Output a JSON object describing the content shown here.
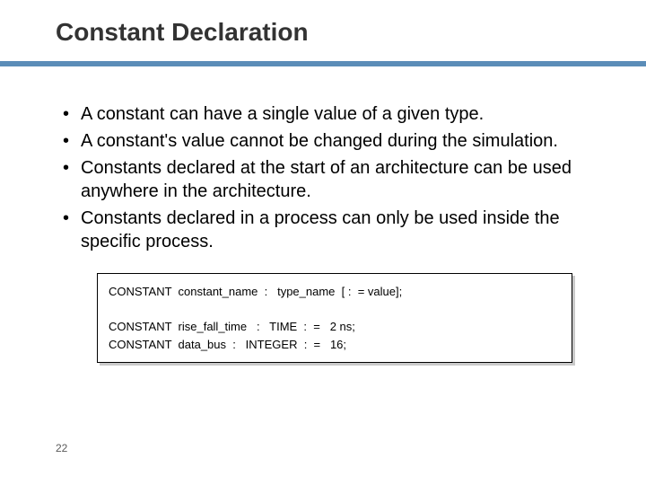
{
  "slide": {
    "title": "Constant Declaration",
    "bullets": [
      "A constant can have a single value of a given type.",
      "A constant's value cannot be changed during the simulation.",
      "Constants declared at the start of an architecture can be used anywhere in the architecture.",
      "Constants declared in a process can only be used inside the specific process."
    ],
    "code": "CONSTANT  constant_name  :   type_name  [ :  = value];\n\nCONSTANT  rise_fall_time   :   TIME  :  =   2 ns;\nCONSTANT  data_bus  :   INTEGER  :  =   16;",
    "page": "22"
  }
}
